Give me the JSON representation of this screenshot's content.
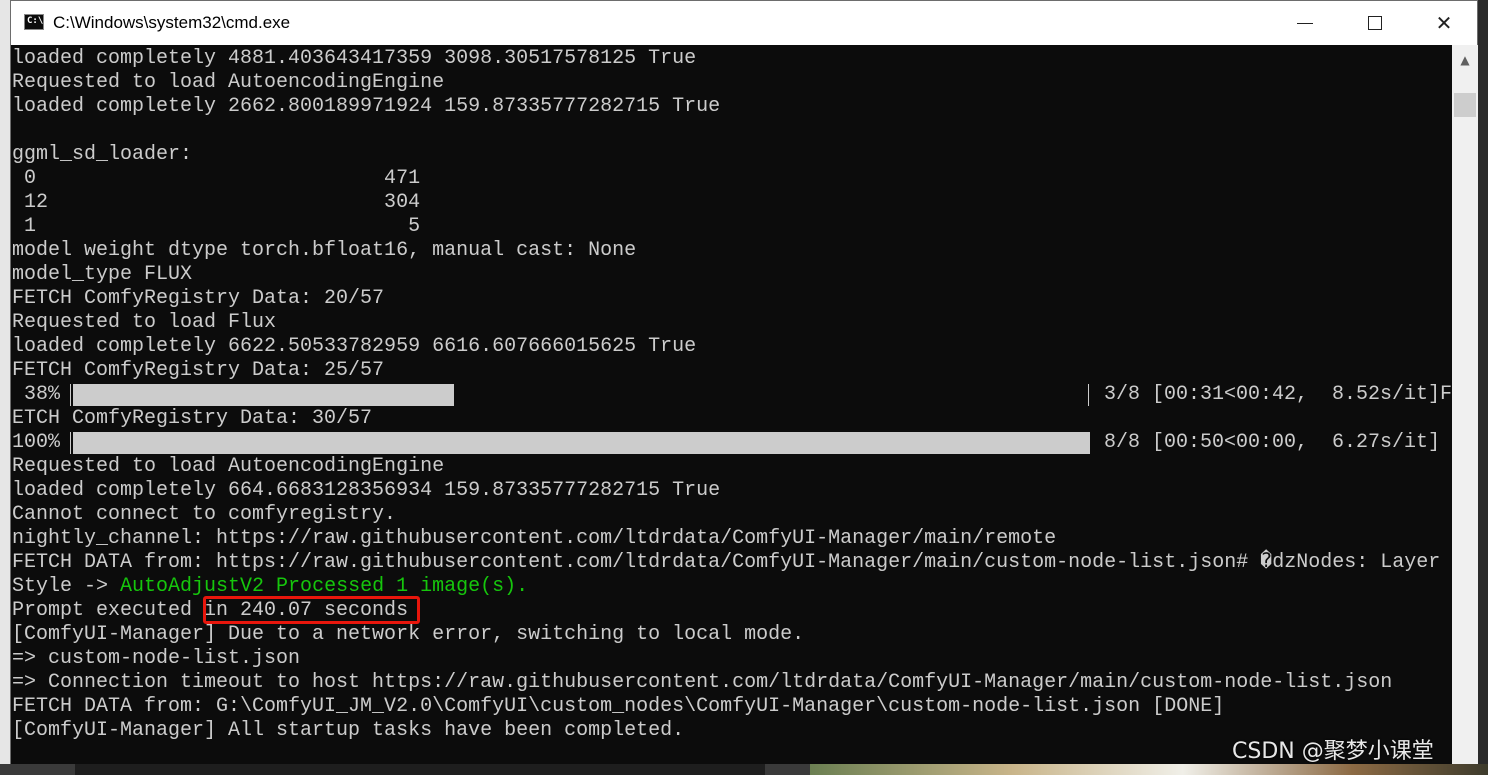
{
  "window": {
    "title": "C:\\Windows\\system32\\cmd.exe",
    "icon_name": "cmd-icon",
    "icon_text": "C:\\",
    "buttons": [
      "minimize-icon",
      "maximize-icon",
      "close-icon"
    ],
    "close_glyph": "✕"
  },
  "console": {
    "lines": [
      "loaded completely 4881.403643417359 3098.30517578125 True",
      "Requested to load AutoencodingEngine",
      "loaded completely 2662.800189971924 159.87335777282715 True",
      "",
      "ggml_sd_loader:",
      " 0                             471",
      " 12                            304",
      " 1                               5",
      "model weight dtype torch.bfloat16, manual cast: None",
      "model_type FLUX",
      "FETCH ComfyRegistry Data: 20/57",
      "Requested to load Flux",
      "loaded completely 6622.50533782959 6616.607666015625 True",
      "FETCH ComfyRegistry Data: 25/57"
    ],
    "progress1": {
      "percent_label": " 38%",
      "fraction": 0.375,
      "tail": "3/8 [00:31<00:42,  8.52s/it]F"
    },
    "after_progress1": "ETCH ComfyRegistry Data: 30/57",
    "progress2": {
      "percent_label": "100%",
      "fraction": 1.0,
      "tail": "8/8 [00:50<00:00,  6.27s/it]"
    },
    "lines2": [
      "Requested to load AutoencodingEngine",
      "loaded completely 664.6683128356934 159.87335777282715 True",
      "Cannot connect to comfyregistry.",
      "nightly_channel: https://raw.githubusercontent.com/ltdrdata/ComfyUI-Manager/main/remote",
      "FETCH DATA from: https://raw.githubusercontent.com/ltdrdata/ComfyUI-Manager/main/custom-node-list.json# �dzNodes: Layer"
    ],
    "style_prefix": "Style -> ",
    "style_green": "AutoAdjustV2 Processed 1 image(s).",
    "prompt_prefix": "Prompt executed ",
    "prompt_highlight": "in 240.07 seconds",
    "lines3": [
      "[ComfyUI-Manager] Due to a network error, switching to local mode.",
      "=> custom-node-list.json",
      "=> Connection timeout to host https://raw.githubusercontent.com/ltdrdata/ComfyUI-Manager/main/custom-node-list.json",
      "FETCH DATA from: G:\\ComfyUI_JM_V2.0\\ComfyUI\\custom_nodes\\ComfyUI-Manager\\custom-node-list.json [DONE]",
      "[ComfyUI-Manager] All startup tasks have been completed."
    ],
    "text_color": "#cccccc",
    "highlight_color": "#16c60c",
    "annotation_box_color": "#e8160c"
  },
  "scrollbar": {
    "up_arrow": "▲"
  },
  "watermark": "CSDN @聚梦小课堂"
}
